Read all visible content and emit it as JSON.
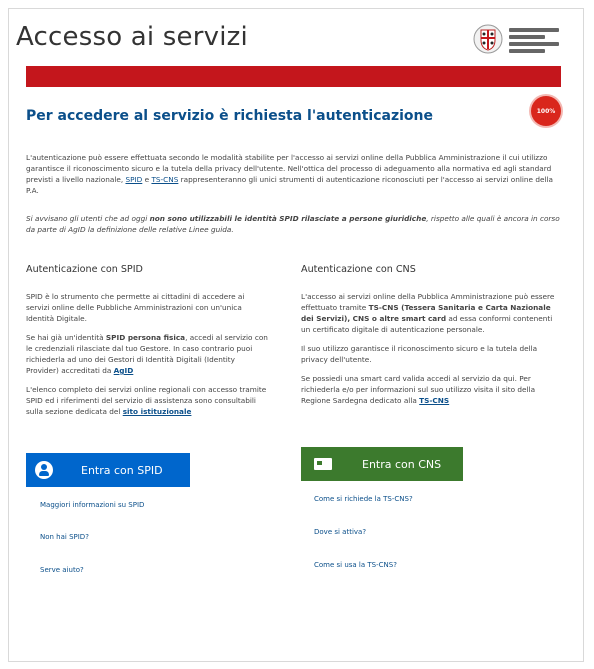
{
  "header": {
    "title": "Accesso ai servizi",
    "logo_icon": "region-emblem-icon"
  },
  "colors": {
    "banner": "#c4161c",
    "spid": "#0066cc",
    "cns": "#3c7a2d",
    "link": "#0b4f8a"
  },
  "subtitle": "Per accedere al servizio è richiesta l'autenticazione",
  "badge": "100%",
  "intro": {
    "p1_a": "L'autenticazione può essere effettuata secondo le modalità stabilite per l'accesso ai servizi online della Pubblica Amministrazione il cui utilizzo garantisce il riconoscimento sicuro e la tutela della privacy dell'utente. Nell'ottica del processo di adeguamento alla normativa ed agli standard previsti a livello nazionale, ",
    "spid_link": "SPID",
    "p1_b": " e ",
    "cns_link": "TS-CNS",
    "p1_c": " rappresenteranno gli unici strumenti di autenticazione riconosciuti per l'accesso ai servizi online della P.A.",
    "p2_a": "Si avvisano gli utenti che ad oggi ",
    "p2_b": "non sono utilizzabili le identità SPID rilasciate a persone giuridiche",
    "p2_c": ", rispetto alle quali è ancora in corso da parte di AgID la definizione delle relative Linee guida."
  },
  "spid": {
    "heading": "Autenticazione con SPID",
    "p1": "SPID è lo strumento che permette ai cittadini di accedere ai servizi online delle Pubbliche Amministrazioni con un'unica Identità Digitale.",
    "p2_a": "Se hai già un'identità ",
    "p2_b": "SPID persona fisica",
    "p2_c": ", accedi al servizio con le credenziali rilasciate dal tuo Gestore. In caso contrario puoi richiederla ad uno dei Gestori di Identità Digitali (Identity Provider) accreditati da ",
    "p2_link": "AgID",
    "p3_a": "L'elenco completo dei servizi online regionali con accesso tramite SPID ed i riferimenti del servizio di assistenza sono consultabili sulla sezione dedicata del ",
    "p3_link": "sito istituzionale",
    "button": "Entra con SPID",
    "button_icon": "user-icon",
    "links": [
      "Maggiori informazioni su SPID",
      "Non hai SPID?",
      "Serve aiuto?"
    ]
  },
  "cns": {
    "heading": "Autenticazione con CNS",
    "p1_a": "L'accesso ai servizi online della Pubblica Amministrazione può essere effettuato tramite ",
    "p1_b": "TS-CNS (Tessera Sanitaria e Carta Nazionale dei Servizi), CNS o altre smart card",
    "p1_c": " ad essa conformi contenenti un certificato digitale di autenticazione personale.",
    "p2": "Il suo utilizzo garantisce il riconoscimento sicuro e la tutela della privacy dell'utente.",
    "p3_a": "Se possiedi una smart card valida accedi al servizio da qui. Per richiederla e/o per informazioni sul suo utilizzo visita il sito della Regione Sardegna dedicato alla ",
    "p3_link": "TS-CNS",
    "button": "Entra con CNS",
    "button_icon": "card-icon",
    "links": [
      "Come si richiede la TS-CNS?",
      "Dove si attiva?",
      "Come si usa la TS-CNS?"
    ]
  }
}
